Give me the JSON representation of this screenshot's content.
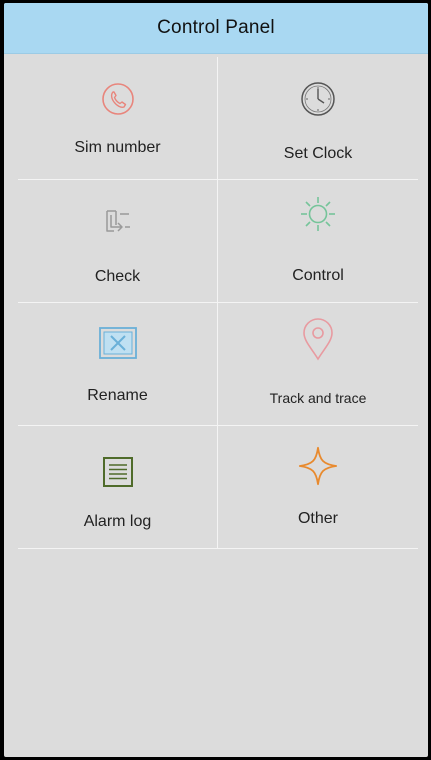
{
  "header": {
    "title": "Control Panel"
  },
  "menu": {
    "items": [
      {
        "label": "Sim number",
        "icon": "phone-icon",
        "color": "#e8857c"
      },
      {
        "label": "Set Clock",
        "icon": "clock-icon",
        "color": "#555555"
      },
      {
        "label": "Check",
        "icon": "check-arrow-icon",
        "color": "#9a9a9a"
      },
      {
        "label": "Control",
        "icon": "sun-icon",
        "color": "#76c49a"
      },
      {
        "label": "Rename",
        "icon": "rename-box-icon",
        "color": "#6ab0d8"
      },
      {
        "label": "Track and trace",
        "icon": "location-pin-icon",
        "color": "#e89aa0"
      },
      {
        "label": "Alarm log",
        "icon": "list-icon",
        "color": "#4f6b2a"
      },
      {
        "label": "Other",
        "icon": "star-icon",
        "color": "#e88a2e"
      }
    ]
  }
}
